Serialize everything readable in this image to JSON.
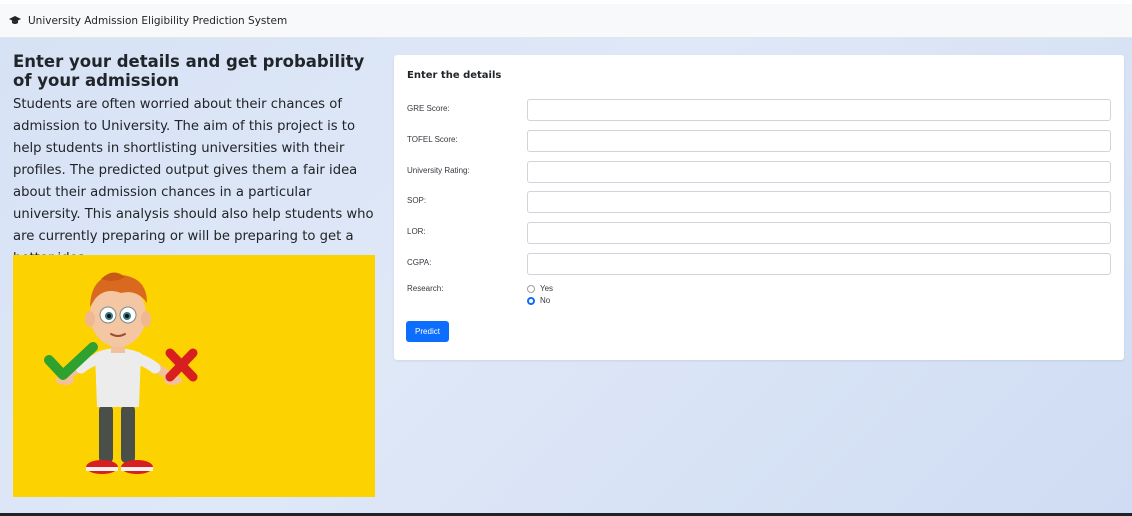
{
  "navbar": {
    "brand": "University Admission Eligibility Prediction System",
    "icon": "graduation-cap-icon"
  },
  "intro": {
    "headline": "Enter your details and get probability of your admission",
    "description": "Students are often worried about their chances of admission to University. The aim of this project is to help students in shortlisting universities with their profiles. The predicted output gives them a fair idea about their admission chances in a particular university. This analysis should also help students who are currently preparing or will be preparing to get a better idea."
  },
  "illustration": {
    "icon": "boy-with-check-and-cross-illustration",
    "bg_color": "#fcd200"
  },
  "form": {
    "title": "Enter the details",
    "fields": [
      {
        "label": "GRE Score:",
        "value": ""
      },
      {
        "label": "TOFEL Score:",
        "value": ""
      },
      {
        "label": "University Rating:",
        "value": ""
      },
      {
        "label": "SOP:",
        "value": ""
      },
      {
        "label": "LOR:",
        "value": ""
      },
      {
        "label": "CGPA:",
        "value": ""
      }
    ],
    "research": {
      "label": "Research:",
      "options": [
        "Yes",
        "No"
      ],
      "selected": "No"
    },
    "submit_label": "Predict",
    "accent": "#0d6efd"
  }
}
